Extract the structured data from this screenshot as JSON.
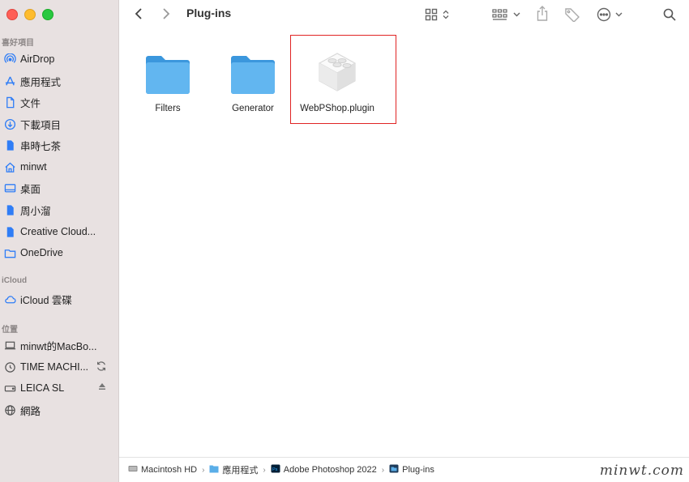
{
  "window": {
    "title": "Plug-ins"
  },
  "sidebar": {
    "favorites_title": "喜好項目",
    "favorites": [
      {
        "label": "AirDrop",
        "icon": "airdrop-icon"
      },
      {
        "label": "應用程式",
        "icon": "applications-icon"
      },
      {
        "label": "文件",
        "icon": "document-icon"
      },
      {
        "label": "下載項目",
        "icon": "downloads-icon"
      },
      {
        "label": "串時七茶",
        "icon": "document-filled-icon"
      },
      {
        "label": "minwt",
        "icon": "home-icon"
      },
      {
        "label": "桌面",
        "icon": "desktop-icon"
      },
      {
        "label": "周小溜",
        "icon": "document-filled-icon"
      },
      {
        "label": "Creative Cloud...",
        "icon": "document-filled-icon"
      },
      {
        "label": "OneDrive",
        "icon": "folder-icon"
      }
    ],
    "icloud_title": "iCloud",
    "icloud": [
      {
        "label": "iCloud 雲碟",
        "icon": "cloud-icon"
      }
    ],
    "locations_title": "位置",
    "locations": [
      {
        "label": "minwt的MacBo...",
        "icon": "laptop-icon"
      },
      {
        "label": "TIME MACHI...",
        "icon": "time-machine-icon"
      },
      {
        "label": "LEICA SL",
        "icon": "drive-icon"
      },
      {
        "label": "網路",
        "icon": "network-icon"
      }
    ]
  },
  "files": [
    {
      "name": "Filters",
      "icon": "folder-icon"
    },
    {
      "name": "Generator",
      "icon": "folder-icon"
    },
    {
      "name": "WebPShop.plugin",
      "icon": "plugin-icon"
    }
  ],
  "pathbar": [
    {
      "label": "Macintosh HD",
      "icon": "hard-drive-icon"
    },
    {
      "label": "應用程式",
      "icon": "folder-icon"
    },
    {
      "label": "Adobe Photoshop 2022",
      "icon": "photoshop-icon"
    },
    {
      "label": "Plug-ins",
      "icon": "folder-icon"
    }
  ],
  "watermark": "minwt.com"
}
